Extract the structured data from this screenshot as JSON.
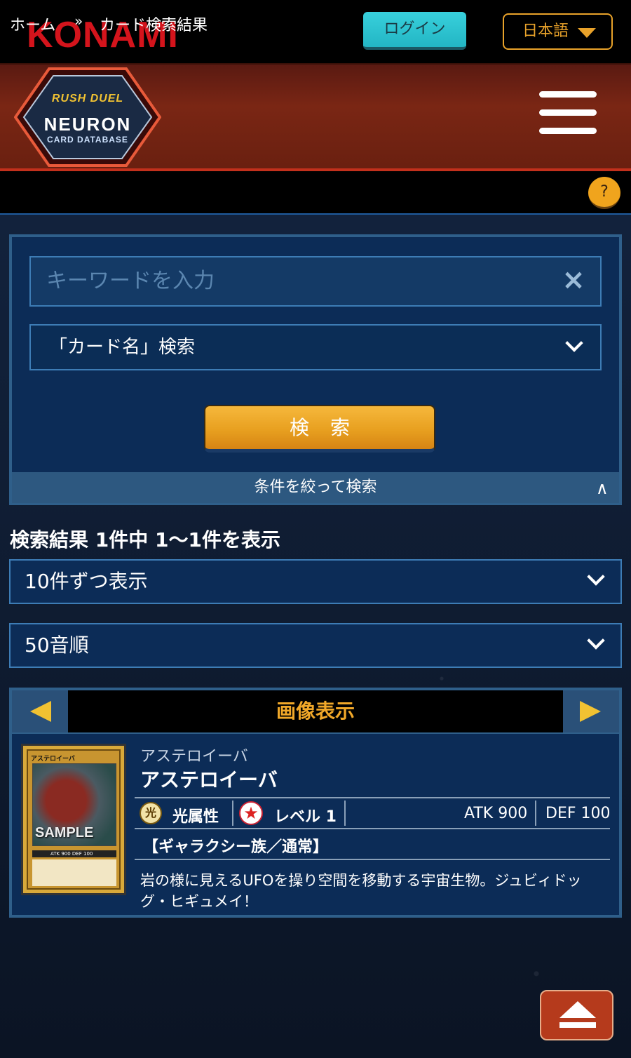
{
  "header": {
    "brand": "KONAMI",
    "login_label": "ログイン",
    "language_label": "日本語"
  },
  "site_logo": {
    "line1": "RUSH DUEL",
    "line2": "NEURON",
    "line3": "CARD DATABASE"
  },
  "breadcrumb": {
    "home": "ホーム",
    "separator": "»",
    "current": "カード検索結果",
    "help": "?"
  },
  "search": {
    "keyword_placeholder": "キーワードを入力",
    "clear_icon": "×",
    "search_type": "「カード名」検索",
    "submit_label": "検索",
    "filter_label": "条件を絞って検索",
    "filter_toggle": "∧"
  },
  "results": {
    "count_text": "検索結果 1件中 1〜1件を表示",
    "per_page": "10件ずつ表示",
    "sort": "50音順",
    "view_mode": "画像表示"
  },
  "cards": [
    {
      "ruby": "アステロイーバ",
      "name": "アステロイーバ",
      "attribute_icon": "光",
      "attribute": "光属性",
      "level": "レベル 1",
      "atk": "ATK 900",
      "def": "DEF 100",
      "type": "【ギャラクシー族／通常】",
      "description": "岩の様に見えるUFOを操り空間を移動する宇宙生物。ジュビィドッグ・ヒギュメイ！",
      "thumb": {
        "name": "アステロイーバ",
        "watermark": "SAMPLE",
        "stats": "ATK 900 DEF 100"
      }
    }
  ],
  "colors": {
    "accent_orange": "#e8a22a",
    "login_cyan": "#23b6c4",
    "brand_red": "#d4141c",
    "panel_navy": "#0c2c57"
  }
}
